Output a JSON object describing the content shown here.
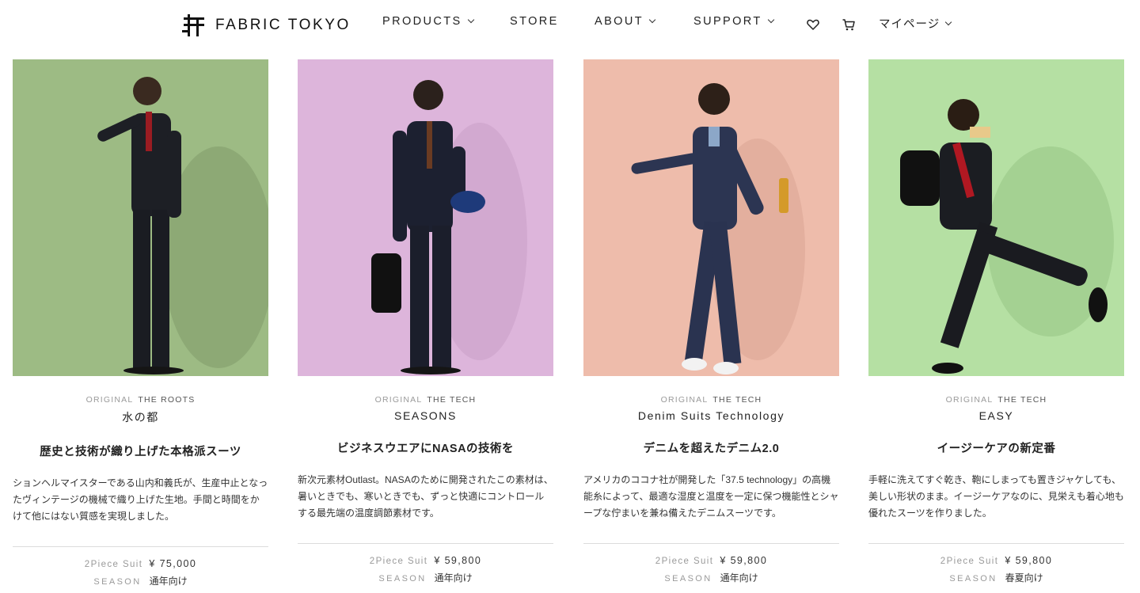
{
  "header": {
    "brand": "FABRIC TOKYO",
    "nav": [
      {
        "label": "PRODUCTS",
        "has_dropdown": true
      },
      {
        "label": "STORE",
        "has_dropdown": false
      },
      {
        "label": "ABOUT",
        "has_dropdown": true
      },
      {
        "label": "SUPPORT",
        "has_dropdown": true
      }
    ],
    "favorites_icon": "heart-icon",
    "cart_icon": "cart-icon",
    "mypage": {
      "label": "マイページ",
      "has_dropdown": true
    }
  },
  "products": [
    {
      "original_label": "ORIGINAL",
      "line": "THE ROOTS",
      "model": "水の都",
      "headline": "歴史と技術が織り上げた本格派スーツ",
      "description": "ションヘルマイスターである山内和義氏が、生産中止となったヴィンテージの機械で織り上げた生地。手間と時間をかけて他にはない質感を実現しました。",
      "price_label": "2Piece Suit",
      "price": "¥ 75,000",
      "season_label": "SEASON",
      "season": "通年向け",
      "bg_color": "#9dbb84"
    },
    {
      "original_label": "ORIGINAL",
      "line": "THE TECH",
      "model": "SEASONS",
      "headline": "ビジネスウエアにNASAの技術を",
      "description": "新次元素材Outlast。NASAのために開発されたこの素材は、暑いときでも、寒いときでも、ずっと快適にコントロールする最先端の温度調節素材です。",
      "price_label": "2Piece Suit",
      "price": "¥ 59,800",
      "season_label": "SEASON",
      "season": "通年向け",
      "bg_color": "#ddb5db"
    },
    {
      "original_label": "ORIGINAL",
      "line": "THE TECH",
      "model": "Denim Suits Technology",
      "headline": "デニムを超えたデニム2.0",
      "description": "アメリカのココナ社が開発した「37.5 technology」の高機能糸によって、最適な湿度と温度を一定に保つ機能性とシャープな佇まいを兼ね備えたデニムスーツです。",
      "price_label": "2Piece Suit",
      "price": "¥ 59,800",
      "season_label": "SEASON",
      "season": "通年向け",
      "bg_color": "#eebcab"
    },
    {
      "original_label": "ORIGINAL",
      "line": "THE TECH",
      "model": "EASY",
      "headline": "イージーケアの新定番",
      "description": "手軽に洗えてすぐ乾き、鞄にしまっても置きジャケしても、美しい形状のまま。イージーケアなのに、見栄えも着心地も優れたスーツを作りました。",
      "price_label": "2Piece Suit",
      "price": "¥ 59,800",
      "season_label": "SEASON",
      "season": "春夏向け",
      "bg_color": "#b5e0a3"
    }
  ]
}
